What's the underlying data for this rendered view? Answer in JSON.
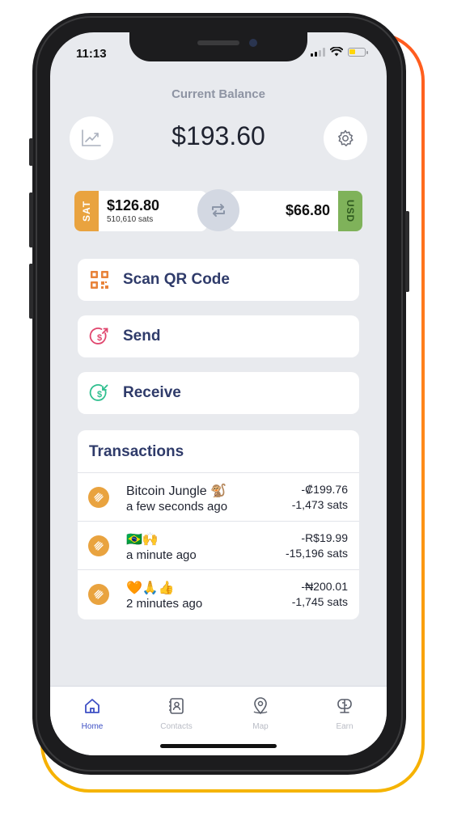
{
  "status_bar": {
    "time": "11:13"
  },
  "balance": {
    "label": "Current Balance",
    "value": "$193.60"
  },
  "wallets": {
    "sat": {
      "tag": "SAT",
      "fiat": "$126.80",
      "sats": "510,610 sats"
    },
    "usd": {
      "tag": "USD",
      "fiat": "$66.80"
    }
  },
  "actions": [
    {
      "label": "Scan QR Code",
      "icon": "qr-code-icon"
    },
    {
      "label": "Send",
      "icon": "send-money-icon"
    },
    {
      "label": "Receive",
      "icon": "receive-money-icon"
    }
  ],
  "transactions": {
    "title": "Transactions",
    "items": [
      {
        "name": "Bitcoin Jungle 🐒",
        "time": "a few seconds ago",
        "amount": "-₡199.76",
        "sats": "-1,473 sats"
      },
      {
        "name": "🇧🇷🙌",
        "time": "a minute ago",
        "amount": "-R$19.99",
        "sats": "-15,196 sats"
      },
      {
        "name": "🧡🙏👍",
        "time": "2 minutes ago",
        "amount": "-₦200.01",
        "sats": "-1,745 sats"
      }
    ]
  },
  "tabs": [
    {
      "label": "Home",
      "icon": "home-icon",
      "active": true
    },
    {
      "label": "Contacts",
      "icon": "contacts-icon",
      "active": false
    },
    {
      "label": "Map",
      "icon": "map-icon",
      "active": false
    },
    {
      "label": "Earn",
      "icon": "earn-icon",
      "active": false
    }
  ],
  "colors": {
    "accent": "#3d4fc4",
    "sat_tag": "#e9a33f",
    "usd_tag": "#7fb25a",
    "action_text": "#2f3b6a",
    "frame_gradient_top": "#ff5a1f",
    "frame_gradient_bottom": "#f5b400"
  }
}
